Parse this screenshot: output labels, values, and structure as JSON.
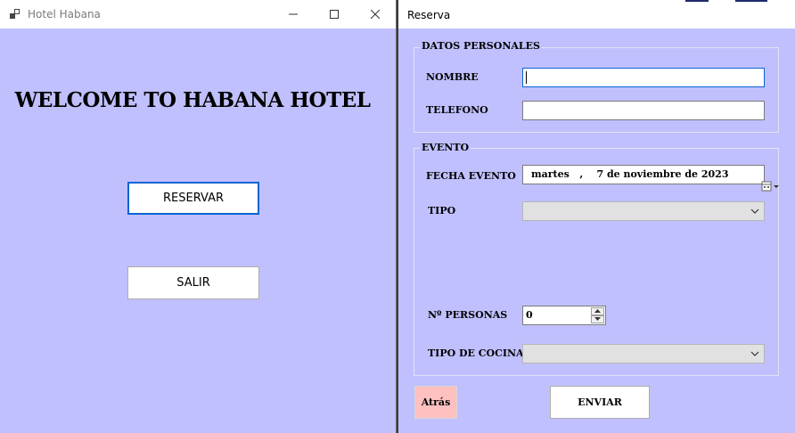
{
  "main_window": {
    "title": "Hotel Habana",
    "heading": "WELCOME TO HABANA HOTEL",
    "reservar_label": "RESERVAR",
    "salir_label": "SALIR"
  },
  "reserva_window": {
    "title": "Reserva",
    "datos_personales": {
      "legend": "DATOS PERSONALES",
      "nombre_label": "NOMBRE",
      "nombre_value": "",
      "telefono_label": "TELEFONO",
      "telefono_value": ""
    },
    "evento": {
      "legend": "EVENTO",
      "fecha_label": "FECHA EVENTO",
      "fecha_value": "martes   ,    7 de noviembre de 2023",
      "tipo_label": "TIPO",
      "tipo_value": "",
      "personas_label": "Nº PERSONAS",
      "personas_value": "0",
      "cocina_label": "TIPO DE COCINA",
      "cocina_value": ""
    },
    "atras_label": "Atrás",
    "enviar_label": "ENVIAR"
  },
  "colors": {
    "background": "#c0c0ff",
    "focus_border": "#0a64d2",
    "atras_button": "#ffc0c0"
  },
  "icons": [
    "app-icon",
    "minimize-icon",
    "maximize-icon",
    "close-icon",
    "calendar-icon",
    "chevron-down-icon",
    "spin-up-icon",
    "spin-down-icon"
  ]
}
